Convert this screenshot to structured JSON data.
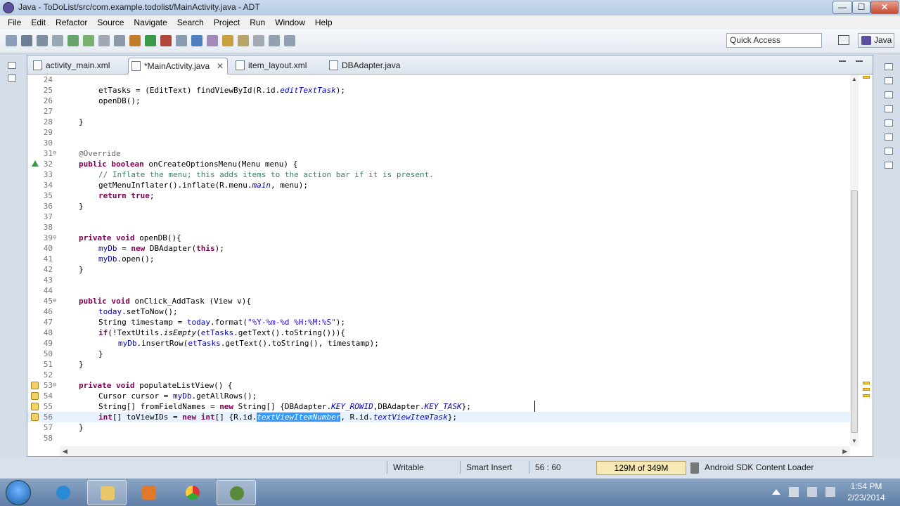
{
  "window": {
    "title": "Java - ToDoList/src/com.example.todolist/MainActivity.java - ADT",
    "controls": {
      "minimize": "—",
      "maximize": "☐",
      "close": "✕"
    }
  },
  "menu": [
    "File",
    "Edit",
    "Refactor",
    "Source",
    "Navigate",
    "Search",
    "Project",
    "Run",
    "Window",
    "Help"
  ],
  "toolbar": {
    "quick_access": "Quick Access",
    "perspective": "Java"
  },
  "tabs": [
    {
      "label": "activity_main.xml"
    },
    {
      "label": "*MainActivity.java",
      "active": true,
      "close": "✕"
    },
    {
      "label": "item_layout.xml"
    },
    {
      "label": "DBAdapter.java"
    }
  ],
  "code": {
    "lines": [
      {
        "n": "24"
      },
      {
        "n": "25"
      },
      {
        "n": "26"
      },
      {
        "n": "27"
      },
      {
        "n": "28"
      },
      {
        "n": "29"
      },
      {
        "n": "30"
      },
      {
        "n": "31",
        "fold": "⊖"
      },
      {
        "n": "32"
      },
      {
        "n": "33"
      },
      {
        "n": "34"
      },
      {
        "n": "35"
      },
      {
        "n": "36"
      },
      {
        "n": "37"
      },
      {
        "n": "38"
      },
      {
        "n": "39",
        "fold": "⊖"
      },
      {
        "n": "40"
      },
      {
        "n": "41"
      },
      {
        "n": "42"
      },
      {
        "n": "43"
      },
      {
        "n": "44"
      },
      {
        "n": "45",
        "fold": "⊖"
      },
      {
        "n": "46"
      },
      {
        "n": "47"
      },
      {
        "n": "48"
      },
      {
        "n": "49"
      },
      {
        "n": "50"
      },
      {
        "n": "51"
      },
      {
        "n": "52"
      },
      {
        "n": "53",
        "fold": "⊖"
      },
      {
        "n": "54"
      },
      {
        "n": "55"
      },
      {
        "n": "56"
      },
      {
        "n": "57"
      },
      {
        "n": "58"
      }
    ],
    "text": {
      "l25a": "etTasks = (EditText) findViewById(R.id.",
      "l25b": "editTextTask",
      "l25c": ");",
      "l26": "openDB();",
      "l28": "}",
      "l31": "@Override",
      "l32a": "public boolean",
      "l32b": " onCreateOptionsMenu(Menu menu) {",
      "l33": "// Inflate the menu; this adds items to the action bar if it is present.",
      "l34a": "getMenuInflater().inflate(R.menu.",
      "l34b": "main",
      "l34c": ", menu);",
      "l35a": "return true",
      "l35b": ";",
      "l36": "}",
      "l39a": "private void",
      "l39b": " openDB(){",
      "l40a": "myDb",
      "l40b": " = ",
      "l40c": "new",
      "l40d": " DBAdapter(",
      "l40e": "this",
      "l40f": ");",
      "l41a": "myDb",
      "l41b": ".open();",
      "l42": "}",
      "l45a": "public void",
      "l45b": " onClick_AddTask (View v){",
      "l46a": "today",
      "l46b": ".setToNow();",
      "l47a": "String timestamp = ",
      "l47b": "today",
      "l47c": ".format(",
      "l47d": "\"%Y-%m-%d %H:%M:%S\"",
      "l47e": ");",
      "l48a": "if",
      "l48b": "(!TextUtils.",
      "l48c": "isEmpty",
      "l48d": "(",
      "l48e": "etTasks",
      "l48f": ".getText().toString())){",
      "l49a": "myDb",
      "l49b": ".insertRow(",
      "l49c": "etTasks",
      "l49d": ".getText().toString(), timestamp);",
      "l50": "}",
      "l51": "}",
      "l53a": "private void",
      "l53b": " populateListView() {",
      "l54a": "Cursor cursor = ",
      "l54b": "myDb",
      "l54c": ".getAllRows();",
      "l55a": "String[] fromFieldNames = ",
      "l55b": "new",
      "l55c": " String[] {DBAdapter.",
      "l55d": "KEY_ROWID",
      "l55e": ",DBAdapter.",
      "l55f": "KEY_TASK",
      "l55g": "};",
      "l56a": "int",
      "l56b": "[] toViewIDs = ",
      "l56c": "new",
      "l56d": " ",
      "l56e": "int",
      "l56f": "[] {R.id.",
      "l56g": "textViewItemNumber",
      "l56h": ", R.id.",
      "l56i": "textViewItemTask",
      "l56j": "};",
      "l57": "}"
    }
  },
  "status": {
    "mode": "Writable",
    "insert": "Smart Insert",
    "position": "56 : 60",
    "heap": "129M of 349M",
    "task": "Android SDK Content Loader"
  },
  "taskbar": {
    "time": "1:54 PM",
    "date": "2/23/2014"
  }
}
